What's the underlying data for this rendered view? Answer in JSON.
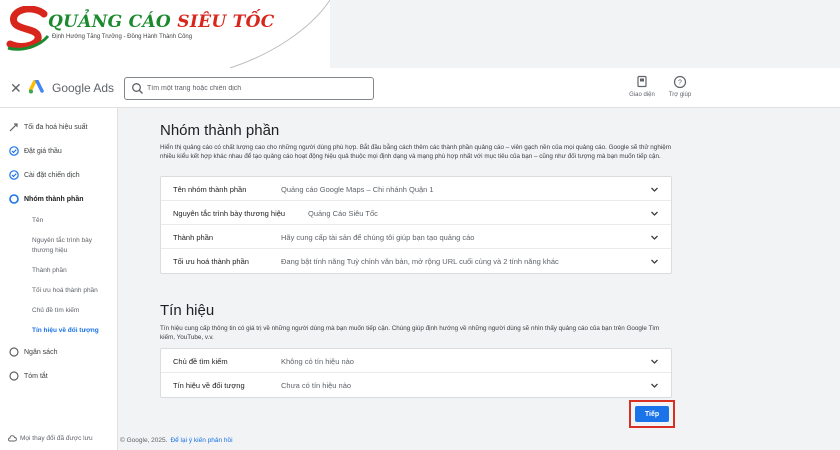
{
  "logo": {
    "title_green": "QUẢNG CÁO ",
    "title_red": "SIÊU TỐC",
    "subtitle": "Định Hướng Tăng Trưởng - Đồng Hành Thành Công"
  },
  "header": {
    "close_icon": "close-icon",
    "app_name": "Google Ads",
    "search_placeholder": "Tìm một trang hoặc chiến dịch",
    "appearance_label": "Giao diện",
    "help_label": "Trợ giúp"
  },
  "sidebar": {
    "items": [
      {
        "label": "Tối đa hoá hiệu suất",
        "icon": "pencil-arrow-icon"
      },
      {
        "label": "Đặt giá thầu",
        "icon": "check-circle-icon"
      },
      {
        "label": "Cài đặt chiến dịch",
        "icon": "check-circle-icon"
      },
      {
        "label": "Nhóm thành phần",
        "icon": "empty-circle-icon"
      },
      {
        "label": "Ngân sách",
        "icon": "empty-circle-icon"
      },
      {
        "label": "Tóm tắt",
        "icon": "empty-circle-icon"
      }
    ],
    "subitems": [
      "Tên",
      "Nguyên tắc trình bày thương hiệu",
      "Thành phần",
      "Tối ưu hoá thành phần",
      "Chủ đề tìm kiếm",
      "Tín hiệu về đối tượng"
    ],
    "footer": "Mọi thay đổi đã được lưu"
  },
  "main": {
    "asset_group": {
      "title": "Nhóm thành phần",
      "description": "Hiển thị quảng cáo có chất lượng cao cho những người dùng phù hợp. Bắt đầu bằng cách thêm các thành phần quảng cáo – viên gạch nền của mọi quảng cáo. Google sẽ thử nghiệm nhiều kiểu kết hợp khác nhau để tạo quảng cáo hoạt động hiệu quả thuộc mọi định dạng và mạng phù hợp nhất với mục tiêu của bạn – cũng như đối tượng mà bạn muốn tiếp cận.",
      "rows": [
        {
          "label": "Tên nhóm thành phần",
          "value": "Quảng cáo Google Maps – Chi nhánh Quận 1"
        },
        {
          "label": "Nguyên tắc trình bày thương hiệu",
          "value": "Quảng Cáo Siêu Tốc"
        },
        {
          "label": "Thành phần",
          "value": "Hãy cung cấp tài sản để chúng tôi giúp bạn tạo quảng cáo"
        },
        {
          "label": "Tối ưu hoá thành phần",
          "value": "Đang bật tính năng Tuỳ chỉnh văn bản, mở rộng URL cuối cùng và 2 tính năng khác"
        }
      ]
    },
    "signals": {
      "title": "Tín hiệu",
      "description": "Tín hiệu cung cấp thông tin có giá trị về những người dùng mà bạn muốn tiếp cận. Chúng giúp định hướng về những người dùng sẽ nhìn thấy quảng cáo của bạn trên Google Tìm kiếm, YouTube, v.v.",
      "rows": [
        {
          "label": "Chủ đề tìm kiếm",
          "value": "Không có tín hiệu nào"
        },
        {
          "label": "Tín hiệu về đối tượng",
          "value": "Chưa có tín hiệu nào"
        }
      ]
    },
    "next_button": "Tiếp",
    "copyright": "© Google, 2025.",
    "feedback_link": "Để lại ý kiến phản hồi"
  },
  "colors": {
    "accent": "#1a73e8",
    "highlight_border": "#d93025",
    "logo_green": "#1b8a2e",
    "logo_red": "#d9261c"
  }
}
